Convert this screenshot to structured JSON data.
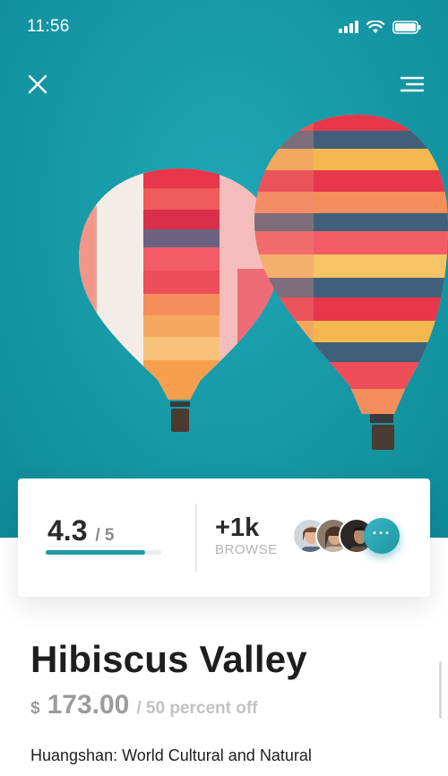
{
  "status_bar": {
    "time": "11:56",
    "icons": [
      "signal-icon",
      "wifi-icon",
      "battery-icon"
    ]
  },
  "nav": {
    "close_icon": "close-icon",
    "menu_icon": "menu-icon"
  },
  "hero": {
    "background_color": "#1a9aa8"
  },
  "stats": {
    "rating": "4.3",
    "rating_max": "/ 5",
    "rating_fraction": 0.86,
    "browse_count": "+1k",
    "browse_label": "BROWSE",
    "more_label": "···"
  },
  "place": {
    "title": "Hibiscus Valley",
    "currency": "$",
    "price": "173.00",
    "price_note": "/ 50 percent off",
    "description": "Huangshan: World Cultural and Natural"
  },
  "colors": {
    "accent": "#1e9aa6",
    "text_dark": "#1e1e1e",
    "text_muted": "#9b9b9b"
  }
}
